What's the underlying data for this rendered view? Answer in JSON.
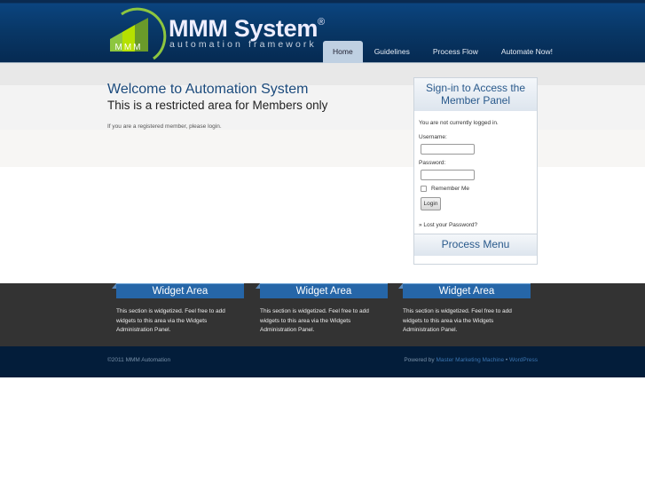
{
  "header": {
    "logo_title": "MMM System",
    "logo_reg": "®",
    "logo_subtitle": "automation framework",
    "logo_badge": "MMM",
    "nav": [
      {
        "label": "Home",
        "active": true
      },
      {
        "label": "Guidelines"
      },
      {
        "label": "Process Flow"
      },
      {
        "label": "Automate Now!"
      }
    ]
  },
  "main": {
    "title": "Welcome to Automation System",
    "subtitle": "This is a restricted area for Members only",
    "text": "If you are a registered member, please login."
  },
  "login": {
    "title": "Sign-in to Access the Member Panel",
    "status": "You are not currently logged in.",
    "username_label": "Username:",
    "username_value": "",
    "password_label": "Password:",
    "password_value": "",
    "remember_label": "Remember Me",
    "remember_checked": false,
    "button": "Login",
    "lost": "» Lost your Password?"
  },
  "process_menu": {
    "title": "Process Menu"
  },
  "widgets": [
    {
      "title": "Widget Area",
      "text": "This section is widgetized. Feel free to add widgets to this area via the Widgets Administration Panel."
    },
    {
      "title": "Widget Area",
      "text": "This section is widgetized. Feel free to add widgets to this area via the Widgets Administration Panel."
    },
    {
      "title": "Widget Area",
      "text": "This section is widgetized. Feel free to add widgets to this area via the Widgets Administration Panel."
    }
  ],
  "footer": {
    "copyright": "©2011 MMM Automation",
    "powered": "Powered by",
    "link1": "Master Marketing Machine",
    "sep": " • ",
    "link2": "WordPress"
  },
  "colors": {
    "accent": "#2666a8",
    "header": "#083766",
    "footer": "#031d3a",
    "logo_green": "#8dc63f"
  }
}
